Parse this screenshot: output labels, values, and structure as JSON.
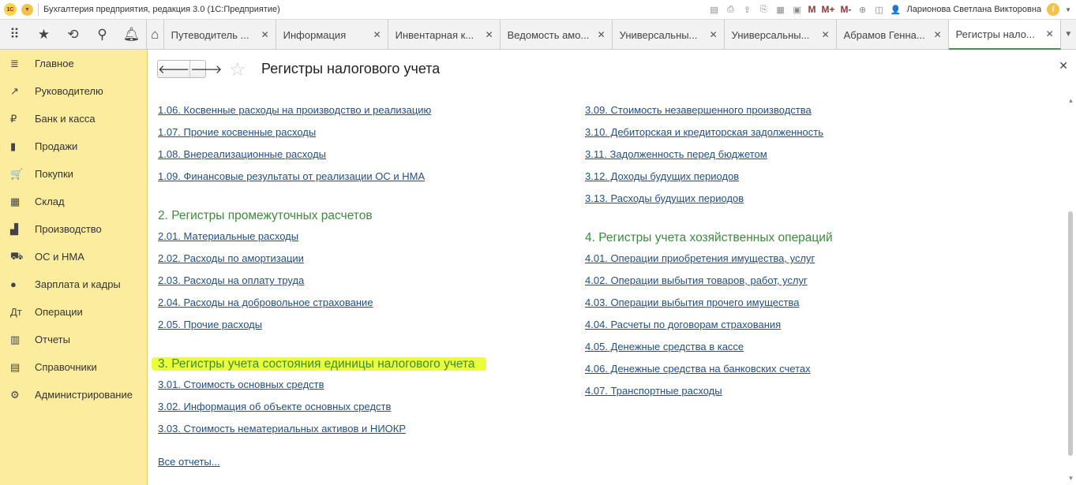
{
  "titlebar": {
    "app_title": "Бухгалтерия предприятия, редакция 3.0   (1С:Предприятие)",
    "logo": "1С",
    "user": "Ларионова Светлана Викторовна",
    "m": "M",
    "mplus": "M+",
    "mminus": "M-"
  },
  "tabs": [
    {
      "label": "Путеводитель ..."
    },
    {
      "label": "Информация"
    },
    {
      "label": "Инвентарная к..."
    },
    {
      "label": "Ведомость амо..."
    },
    {
      "label": "Универсальны..."
    },
    {
      "label": "Универсальны..."
    },
    {
      "label": "Абрамов Генна..."
    },
    {
      "label": "Регистры нало...",
      "active": true
    }
  ],
  "sidebar": [
    {
      "label": "Главное",
      "icon": "≣"
    },
    {
      "label": "Руководителю",
      "icon": "↗"
    },
    {
      "label": "Банк и касса",
      "icon": "₽"
    },
    {
      "label": "Продажи",
      "icon": "▮"
    },
    {
      "label": "Покупки",
      "icon": "🛒"
    },
    {
      "label": "Склад",
      "icon": "▦"
    },
    {
      "label": "Производство",
      "icon": "▟"
    },
    {
      "label": "ОС и НМА",
      "icon": "⛟"
    },
    {
      "label": "Зарплата и кадры",
      "icon": "●"
    },
    {
      "label": "Операции",
      "icon": "Дт"
    },
    {
      "label": "Отчеты",
      "icon": "▥"
    },
    {
      "label": "Справочники",
      "icon": "▤"
    },
    {
      "label": "Администрирование",
      "icon": "⚙"
    }
  ],
  "page": {
    "title": "Регистры налогового учета",
    "all_reports": "Все отчеты..."
  },
  "left_column": [
    {
      "type": "link",
      "text": "1.06. Косвенные расходы на производство и реализацию"
    },
    {
      "type": "link",
      "text": "1.07. Прочие косвенные расходы"
    },
    {
      "type": "link",
      "text": "1.08. Внереализационные расходы"
    },
    {
      "type": "link",
      "text": "1.09. Финансовые результаты от реализации ОС и НМА"
    },
    {
      "type": "heading",
      "text": "2. Регистры промежуточных расчетов"
    },
    {
      "type": "link",
      "text": "2.01. Материальные расходы"
    },
    {
      "type": "link",
      "text": "2.02. Расходы по амортизации"
    },
    {
      "type": "link",
      "text": "2.03. Расходы на оплату труда"
    },
    {
      "type": "link",
      "text": "2.04. Расходы на добровольное страхование"
    },
    {
      "type": "link",
      "text": "2.05. Прочие расходы"
    },
    {
      "type": "heading",
      "text": "3. Регистры учета состояния единицы налогового учета",
      "highlighted": true
    },
    {
      "type": "link",
      "text": "3.01. Стоимость основных средств"
    },
    {
      "type": "link",
      "text": "3.02. Информация об объекте основных средств"
    },
    {
      "type": "link",
      "text": "3.03. Стоимость нематериальных активов и НИОКР"
    }
  ],
  "right_column": [
    {
      "type": "link",
      "text": "3.09. Стоимость незавершенного производства"
    },
    {
      "type": "link",
      "text": "3.10. Дебиторская и кредиторская задолженность"
    },
    {
      "type": "link",
      "text": "3.11. Задолженность перед бюджетом"
    },
    {
      "type": "link",
      "text": "3.12. Доходы будущих периодов"
    },
    {
      "type": "link",
      "text": "3.13. Расходы будущих периодов"
    },
    {
      "type": "heading",
      "text": "4. Регистры учета хозяйственных операций"
    },
    {
      "type": "link",
      "text": "4.01. Операции приобретения имущества, услуг"
    },
    {
      "type": "link",
      "text": "4.02. Операции выбытия товаров, работ, услуг"
    },
    {
      "type": "link",
      "text": "4.03. Операции выбытия прочего имущества"
    },
    {
      "type": "link",
      "text": "4.04. Расчеты по договорам страхования"
    },
    {
      "type": "link",
      "text": "4.05. Денежные средства в кассе"
    },
    {
      "type": "link",
      "text": "4.06. Денежные средства на банковских счетах"
    },
    {
      "type": "link",
      "text": "4.07. Транспортные расходы"
    }
  ],
  "colors": {
    "accent": "#3c9a4a",
    "sidebar": "#fcec9e",
    "link": "#1f4f8a",
    "heading": "#3d8a3d",
    "highlight": "#eaff3a"
  }
}
